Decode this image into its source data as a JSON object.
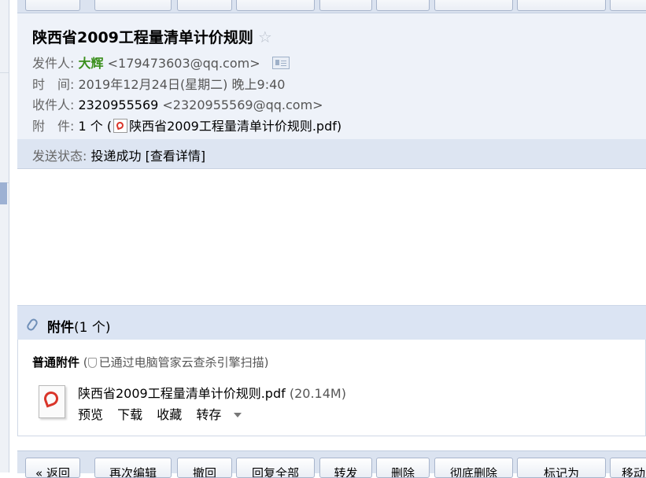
{
  "email": {
    "subject": "陕西省2009工程量清单计价规则",
    "star_icon": "☆",
    "sender_label": "发件人:",
    "sender_name": "大辉",
    "sender_email": "<179473603@qq.com>",
    "time_label": "时　间:",
    "time_value": "2019年12月24日(星期二) 晚上9:40",
    "recipient_label": "收件人:",
    "recipient_name": "2320955569",
    "recipient_email": "<2320955569@qq.com>",
    "attach_label": "附　件:",
    "attach_count": "1 个 (",
    "attach_filename": "陕西省2009工程量清单计价规则.pdf",
    "attach_close": ")"
  },
  "status": {
    "label": "发送状态:",
    "value": "投递成功",
    "details": "[查看详情]"
  },
  "attachments": {
    "title": "附件",
    "count": "(1 个)",
    "normal_label": "普通附件",
    "scan_note": "已通过电脑管家云查杀引擎扫描)",
    "scan_open": "(",
    "file_name": "陕西省2009工程量清单计价规则.pdf",
    "file_size": "(20.14M)",
    "actions": [
      "预览",
      "下载",
      "收藏",
      "转存"
    ]
  },
  "toolbar_bottom": {
    "buttons": [
      "« 返回",
      "再次编辑",
      "撤回",
      "回复全部",
      "转发",
      "删除",
      "彻底删除",
      "标记为",
      "移动"
    ]
  },
  "colors": {
    "sender_name": "#3a8f1c",
    "header_bg": "#eef2f9",
    "status_bg": "#dde5f2",
    "attach_header_bg": "#dbe4f3",
    "pdf_red": "#d9352a"
  },
  "icons": [
    "star-icon",
    "vcard-icon",
    "pdf-icon",
    "paperclip-icon",
    "shield-icon",
    "chevron-down-icon"
  ]
}
